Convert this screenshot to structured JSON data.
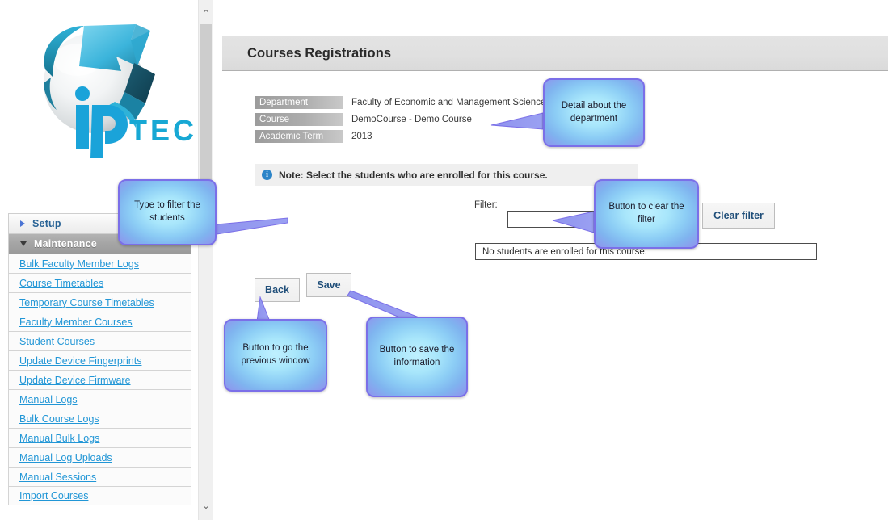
{
  "logo": {
    "wordmark": "TECH",
    "mark_letter": "ip",
    "alt": "iP TECH logo"
  },
  "left_panel": {
    "scrollbar": {
      "up_arrow": "⌃",
      "down_arrow": "⌄"
    },
    "sections": [
      {
        "label": "Setup",
        "state": "collapsed",
        "items": []
      },
      {
        "label": "Maintenance",
        "state": "expanded",
        "items": [
          {
            "label": "Bulk Faculty Member Logs"
          },
          {
            "label": "Course Timetables"
          },
          {
            "label": "Temporary Course Timetables"
          },
          {
            "label": "Faculty Member Courses"
          },
          {
            "label": "Student Courses"
          },
          {
            "label": "Update Device Fingerprints"
          },
          {
            "label": "Update Device Firmware"
          },
          {
            "label": "Manual Logs"
          },
          {
            "label": "Bulk Course Logs"
          },
          {
            "label": "Manual Bulk Logs"
          },
          {
            "label": "Manual Log Uploads"
          },
          {
            "label": "Manual Sessions"
          },
          {
            "label": "Import Courses"
          }
        ]
      }
    ]
  },
  "header": {
    "title": "Courses Registrations"
  },
  "info": {
    "rows": [
      {
        "label": "Department",
        "value": "Faculty of Economic and Management Sciences"
      },
      {
        "label": "Course",
        "value": "DemoCourse - Demo Course"
      },
      {
        "label": "Academic Term",
        "value": "2013"
      }
    ]
  },
  "note": {
    "icon": "i",
    "text": "Note: Select the students who are enrolled for this course."
  },
  "filter": {
    "label": "Filter:",
    "value": "",
    "placeholder": "",
    "clear_button": "Clear filter"
  },
  "results": {
    "message": "No students are enrolled for this course."
  },
  "actions": {
    "back": "Back",
    "save": "Save"
  },
  "callouts": [
    {
      "id": "filter",
      "text": "Type to filter the students"
    },
    {
      "id": "department",
      "text": "Detail about the department"
    },
    {
      "id": "clear",
      "text": "Button to clear the filter"
    },
    {
      "id": "back",
      "text": "Button to go the previous window"
    },
    {
      "id": "save",
      "text": "Button to save the information"
    }
  ],
  "colors": {
    "link": "#2196d6",
    "callout_fill": "#a8e6fb",
    "callout_border": "#7b6fe8",
    "button_text": "#1f4e79",
    "note_icon": "#2b84c8",
    "logo_cyan": "#29abd6"
  }
}
